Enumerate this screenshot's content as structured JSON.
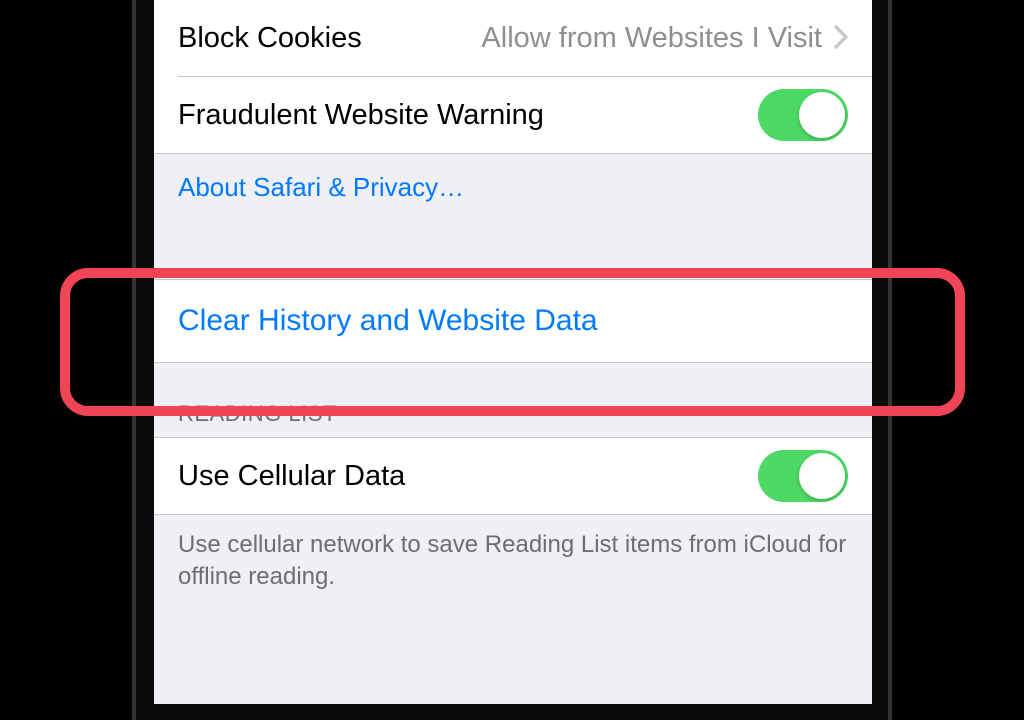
{
  "privacy": {
    "block_cookies_label": "Block Cookies",
    "block_cookies_value": "Allow from Websites I Visit",
    "fraud_warning_label": "Fraudulent Website Warning",
    "about_link": "About Safari & Privacy…"
  },
  "clear": {
    "label": "Clear History and Website Data"
  },
  "reading_list": {
    "header": "READING LIST",
    "cellular_label": "Use Cellular Data",
    "footer": "Use cellular network to save Reading List items from iCloud for offline reading."
  }
}
